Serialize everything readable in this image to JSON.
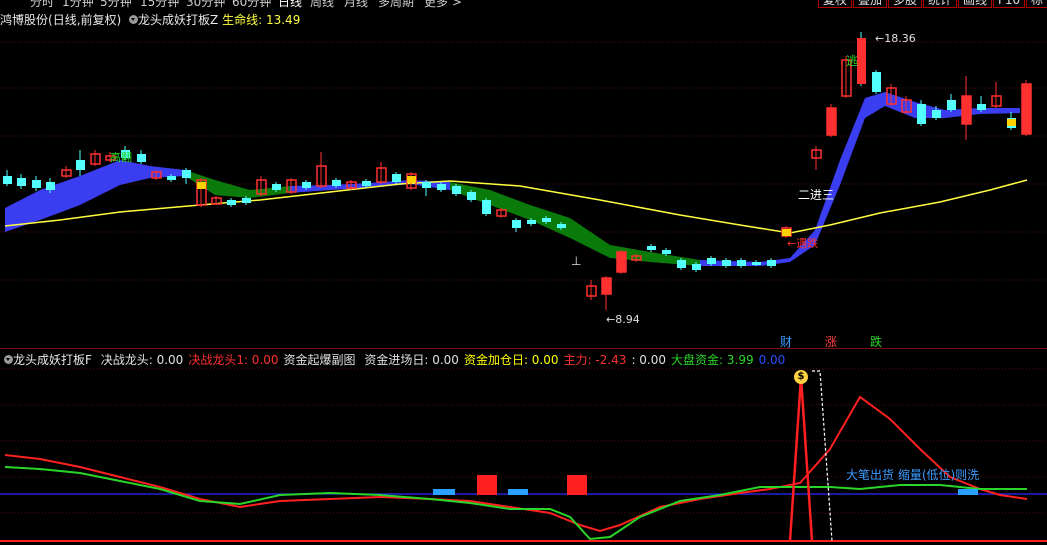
{
  "toolbar": {
    "period_tabs": [
      "分时",
      "1分钟",
      "5分钟",
      "15分钟",
      "30分钟",
      "60分钟",
      "日线",
      "周线",
      "月线",
      "多周期",
      "更多 >"
    ],
    "active_tab": "日线",
    "buttons": [
      "复权",
      "叠加",
      "多股",
      "统计",
      "画线",
      "F10",
      "标记"
    ]
  },
  "main_panel": {
    "stock_name": "鸿博股份",
    "period_label": "(日线,前复权)",
    "indicator_name": "龙头成妖打板Z",
    "lifeline_label": "生命线:",
    "lifeline_value": "13.49",
    "high_label": "18.36",
    "low_label": "8.94",
    "annotations": {
      "hunchuan": "高翻",
      "jin_er_jin_san": "二进三",
      "cha_dian": "←遇跌",
      "tao": "逃",
      "bottom_marker": "⊥"
    },
    "event_tags": [
      {
        "text": "财",
        "color": "#3a9bff"
      },
      {
        "text": "涨",
        "color": "#ff4040"
      },
      {
        "text": "跌",
        "color": "#29d629"
      }
    ]
  },
  "sub_panel": {
    "indicator_name": "龙头成妖打板F",
    "items": [
      {
        "label": "决战龙头:",
        "value": "0.00",
        "color": "#e0e0e0"
      },
      {
        "label": "决战龙头1:",
        "value": "0.00",
        "color": "#ff3030"
      },
      {
        "label": "资金起爆副图",
        "value": "",
        "color": "#e0e0e0"
      },
      {
        "label": "资金进场日:",
        "value": "0.00",
        "color": "#e0e0e0"
      },
      {
        "label": "资金加仓日:",
        "value": "0.00",
        "color": "#ffff00"
      },
      {
        "label": "主力:",
        "value": "-2.43",
        "color": "#ff3030"
      },
      {
        "label": ":",
        "value": "0.00",
        "color": "#e0e0e0"
      },
      {
        "label": "大盘资金:",
        "value": "3.99",
        "color": "#29d629"
      },
      {
        "label": "",
        "value": "0.00",
        "color": "#2a4dff"
      }
    ],
    "note": "大笔出货 缩量(低位)则洗",
    "money_icon": "$"
  },
  "colors": {
    "up": "#ff3030",
    "down": "#54ffff",
    "ribbon_up": "#3a3df0",
    "ribbon_down": "#0a7a0a",
    "lifeline": "#ffff40",
    "grid": "#5a0f0f"
  }
}
